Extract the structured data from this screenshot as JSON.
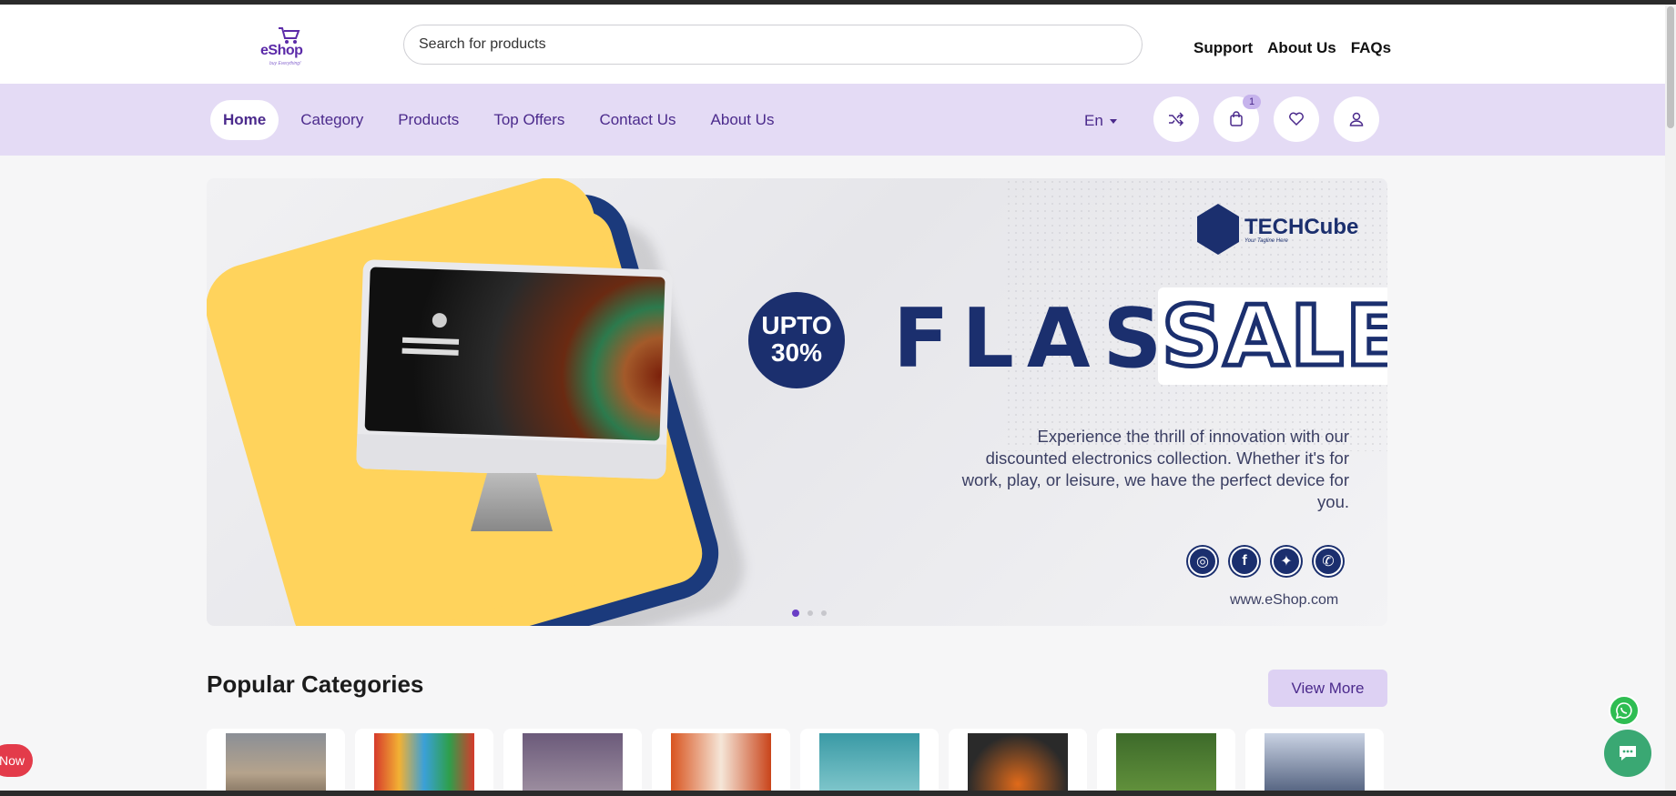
{
  "header": {
    "logo_text": "eShop",
    "logo_tagline": "buy Everything!",
    "search_placeholder": "Search for products",
    "top_links": [
      "Support",
      "About Us",
      "FAQs"
    ]
  },
  "nav": {
    "links": [
      "Home",
      "Category",
      "Products",
      "Top Offers",
      "Contact Us",
      "About Us"
    ],
    "active": "Home",
    "language": "En",
    "cart_count": "1",
    "icons": [
      "shuffle-icon",
      "shopping-bag-icon",
      "heart-icon",
      "user-icon"
    ]
  },
  "hero": {
    "badge_line1": "UPTO",
    "badge_line2": "30%",
    "flash": "FLASH",
    "sale": "SALE",
    "brand": "TECHCube",
    "brand_tagline": "Your Tagline Here",
    "description": "Experience the thrill of innovation with our discounted electronics collection. Whether it's for work, play, or leisure, we have the perfect device for you.",
    "website": "www.eShop.com",
    "social_icons": [
      "instagram-icon",
      "facebook-icon",
      "twitter-icon",
      "whatsapp-icon"
    ],
    "slides_total": 3,
    "active_slide": 1
  },
  "popular": {
    "title": "Popular Categories",
    "view_more": "View More"
  },
  "floating": {
    "left_pill": "Now",
    "whatsapp": "whatsapp-icon",
    "chat": "chat-icon"
  },
  "colors": {
    "primary": "#4b2a8c",
    "nav_bg": "#e4dbf5",
    "hero_navy": "#1b2f6e",
    "hero_yellow": "#ffd35c"
  }
}
